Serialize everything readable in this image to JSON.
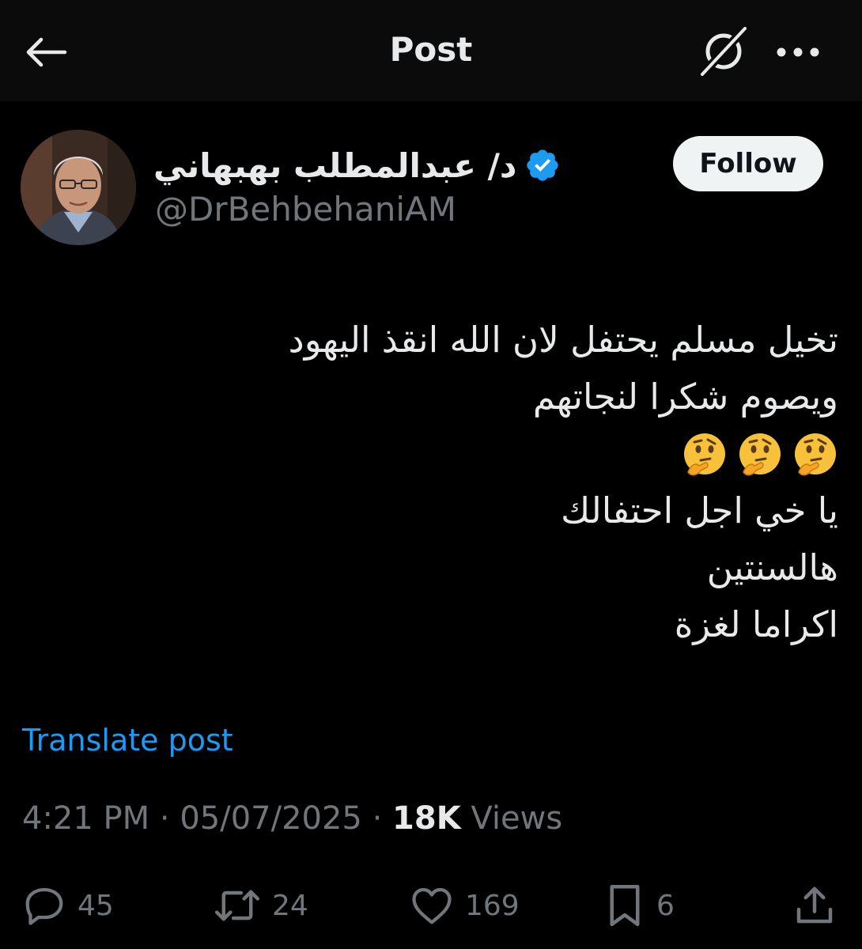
{
  "header": {
    "title": "Post",
    "back_icon": "arrow-left-icon",
    "grok_icon": "grok-icon",
    "more_icon": "more-dots-icon"
  },
  "author": {
    "display_name": "د/ عبدالمطلب بهبهاني",
    "handle": "@DrBehbehaniAM",
    "verified": true,
    "verified_color": "#1d9bf0"
  },
  "follow_label": "Follow",
  "post": {
    "lines": [
      "تخيل مسلم يحتفل لان الله انقذ اليهود",
      "ويصوم شكرا لنجاتهم",
      "🤔🤔🤔",
      "يا خي اجل احتفالك",
      "هالسنتين",
      "اكراما لغزة"
    ]
  },
  "translate_label": "Translate post",
  "meta": {
    "time": "4:21 PM",
    "separator": "·",
    "date": "05/07/2025",
    "views_count": "18K",
    "views_label": "Views"
  },
  "actions": {
    "replies": "45",
    "reposts": "24",
    "likes": "169",
    "bookmarks": "6"
  },
  "colors": {
    "background": "#000000",
    "header_background": "#0b0b0b",
    "text_primary": "#e7e9ea",
    "text_secondary": "#71767b",
    "link": "#1d9bf0"
  }
}
